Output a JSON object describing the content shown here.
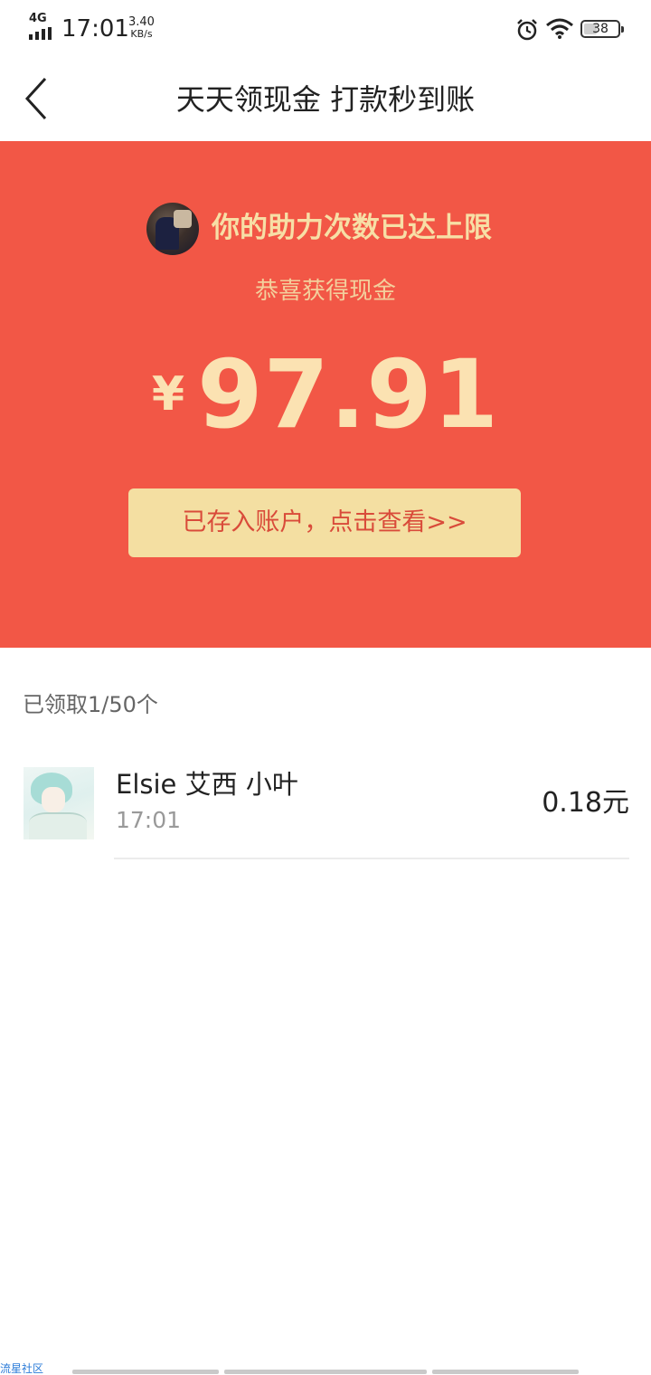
{
  "status_bar": {
    "network": "4G",
    "time": "17:01",
    "speed_value": "3.40",
    "speed_unit": "KB/s",
    "battery": "38",
    "battery_level": 0.38
  },
  "header": {
    "title": "天天领现金 打款秒到账"
  },
  "banner": {
    "help_message": "你的助力次数已达上限",
    "congrats": "恭喜获得现金",
    "currency": "¥",
    "amount": "97.91",
    "deposit_button": "已存入账户，点击查看>>"
  },
  "received": {
    "count_label": "已领取1/50个",
    "records": [
      {
        "name": "Elsie 艾西 小叶",
        "time": "17:01",
        "amount": "0.18元"
      }
    ]
  },
  "watermark": "流星社区",
  "colors": {
    "banner_red": "#f25746",
    "gold_text": "#f7dfa6",
    "button_bg": "#f4dfa2",
    "button_text": "#d94b3a"
  }
}
